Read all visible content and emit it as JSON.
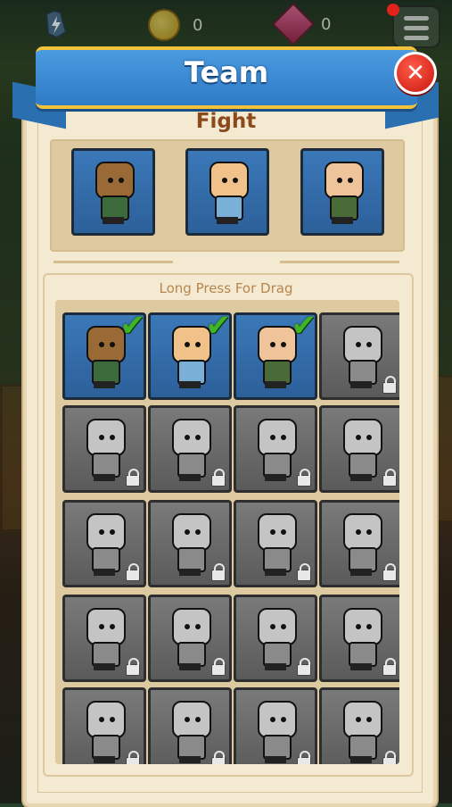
{
  "hud": {
    "coins": "0",
    "gems": "0",
    "energy_icon": "lightning-icon",
    "coin_icon": "coin-icon",
    "gem_icon": "gem-icon",
    "menu_icon": "hamburger-menu-icon"
  },
  "dialog": {
    "title": "Team",
    "close_icon": "close-icon",
    "close_glyph": "✕",
    "fight_label": "Fight",
    "drag_hint": "Long Press For Drag"
  },
  "colors": {
    "ribbon": "#3a8ad4",
    "ribbon_trim": "#f2c23a",
    "close": "#d8241a",
    "panel": "#f4ead2",
    "fight_title": "#8c4a1c",
    "check": "#3fb426"
  },
  "fight_slots": [
    {
      "name": "tiki-warrior",
      "head": "#9a6a36",
      "body": "#3b6b3a"
    },
    {
      "name": "red-bandana-pirate",
      "head": "#f0c28a",
      "body": "#7ab0d8"
    },
    {
      "name": "elf-archer",
      "head": "#f0c49a",
      "body": "#4a6a38"
    }
  ],
  "roster": [
    {
      "name": "tiki-warrior",
      "locked": false,
      "selected": true,
      "head": "#9a6a36",
      "body": "#3b6b3a"
    },
    {
      "name": "red-bandana-pirate",
      "locked": false,
      "selected": true,
      "head": "#f0c28a",
      "body": "#7ab0d8"
    },
    {
      "name": "elf-archer",
      "locked": false,
      "selected": true,
      "head": "#f0c49a",
      "body": "#4a6a38"
    },
    {
      "name": "horned-viking",
      "locked": true,
      "selected": false
    },
    {
      "name": "capped-soldier",
      "locked": true,
      "selected": false
    },
    {
      "name": "helmet-worker",
      "locked": true,
      "selected": false
    },
    {
      "name": "fedora-gangster",
      "locked": true,
      "selected": false
    },
    {
      "name": "vampire",
      "locked": true,
      "selected": false
    },
    {
      "name": "masked-ninja",
      "locked": true,
      "selected": false
    },
    {
      "name": "long-haired-rogue",
      "locked": true,
      "selected": false
    },
    {
      "name": "box-robot",
      "locked": true,
      "selected": false
    },
    {
      "name": "gas-mask-trooper",
      "locked": true,
      "selected": false
    },
    {
      "name": "welder",
      "locked": true,
      "selected": false
    },
    {
      "name": "block-head",
      "locked": true,
      "selected": false
    },
    {
      "name": "astronaut",
      "locked": true,
      "selected": false
    },
    {
      "name": "deep-sea-diver",
      "locked": true,
      "selected": false
    },
    {
      "name": "pharaoh",
      "locked": true,
      "selected": false
    },
    {
      "name": "black-ninja",
      "locked": true,
      "selected": false
    },
    {
      "name": "hooded-elf",
      "locked": true,
      "selected": false
    },
    {
      "name": "armored-knight",
      "locked": true,
      "selected": false
    }
  ]
}
